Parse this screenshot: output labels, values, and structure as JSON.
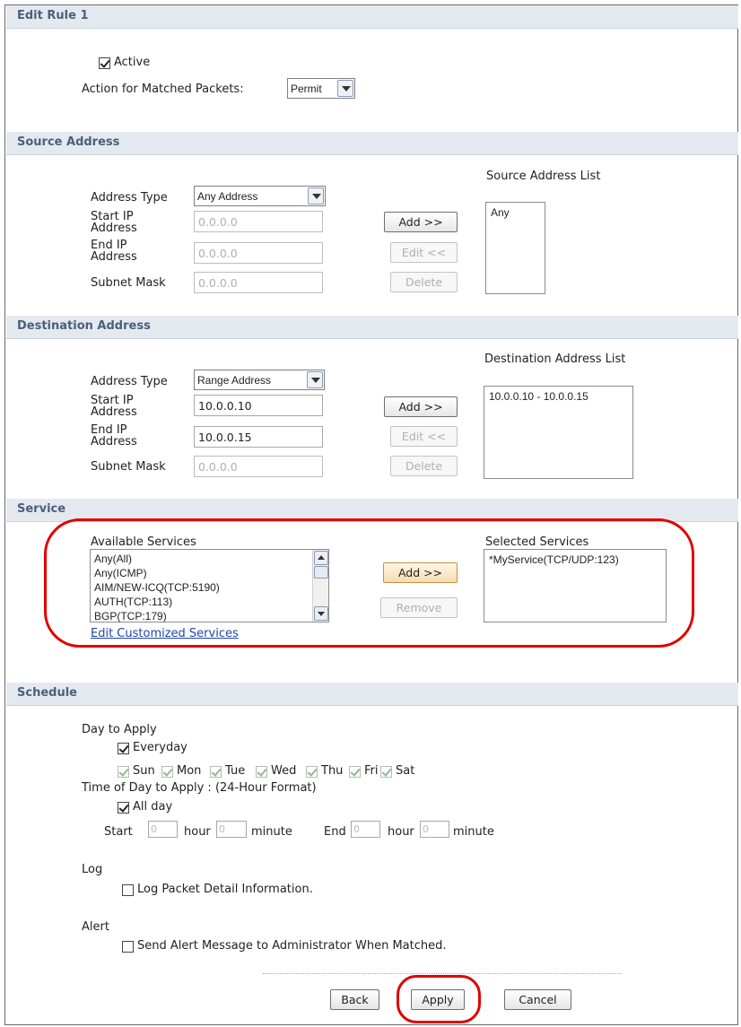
{
  "edit_rule": {
    "title": "Edit Rule 1",
    "active_label": "Active",
    "active_checked": true,
    "action_label": "Action for Matched Packets:",
    "action_value": "Permit"
  },
  "source": {
    "title": "Source Address",
    "list_title": "Source Address List",
    "address_type_label": "Address Type",
    "address_type_value": "Any Address",
    "start_ip_label_1": "Start IP",
    "start_ip_label_2": "Address",
    "start_ip_value": "0.0.0.0",
    "end_ip_label_1": "End IP",
    "end_ip_label_2": "Address",
    "end_ip_value": "0.0.0.0",
    "subnet_label": "Subnet Mask",
    "subnet_value": "0.0.0.0",
    "add_label": "Add >>",
    "edit_label": "Edit <<",
    "delete_label": "Delete",
    "list_items": [
      "Any"
    ]
  },
  "destination": {
    "title": "Destination Address",
    "list_title": "Destination Address List",
    "address_type_label": "Address Type",
    "address_type_value": "Range Address",
    "start_ip_label_1": "Start IP",
    "start_ip_label_2": "Address",
    "start_ip_value": "10.0.0.10",
    "end_ip_label_1": "End IP",
    "end_ip_label_2": "Address",
    "end_ip_value": "10.0.0.15",
    "subnet_label": "Subnet Mask",
    "subnet_value": "0.0.0.0",
    "add_label": "Add >>",
    "edit_label": "Edit <<",
    "delete_label": "Delete",
    "list_items": [
      "10.0.0.10 - 10.0.0.15"
    ]
  },
  "service": {
    "title": "Service",
    "available_label": "Available Services",
    "selected_label": "Selected Services",
    "available_items": [
      "Any(All)",
      "Any(ICMP)",
      "AIM/NEW-ICQ(TCP:5190)",
      "AUTH(TCP:113)",
      "BGP(TCP:179)"
    ],
    "selected_items": [
      "*MyService(TCP/UDP:123)"
    ],
    "add_label": "Add >>",
    "remove_label": "Remove",
    "edit_link": "Edit Customized Services"
  },
  "schedule": {
    "title": "Schedule",
    "day_label": "Day to Apply",
    "everyday_label": "Everyday",
    "days": [
      "Sun",
      "Mon",
      "Tue",
      "Wed",
      "Thu",
      "Fri",
      "Sat"
    ],
    "time_label": "Time of Day to Apply : (24-Hour Format)",
    "allday_label": "All day",
    "start_label": "Start",
    "end_label": "End",
    "hour_label": "hour",
    "minute_label": "minute",
    "start_hour": "0",
    "start_minute": "0",
    "end_hour": "0",
    "end_minute": "0"
  },
  "log": {
    "title": "Log",
    "option_label": "Log Packet Detail Information."
  },
  "alert": {
    "title": "Alert",
    "option_label": "Send Alert Message to Administrator When Matched."
  },
  "footer": {
    "back_label": "Back",
    "apply_label": "Apply",
    "cancel_label": "Cancel"
  }
}
